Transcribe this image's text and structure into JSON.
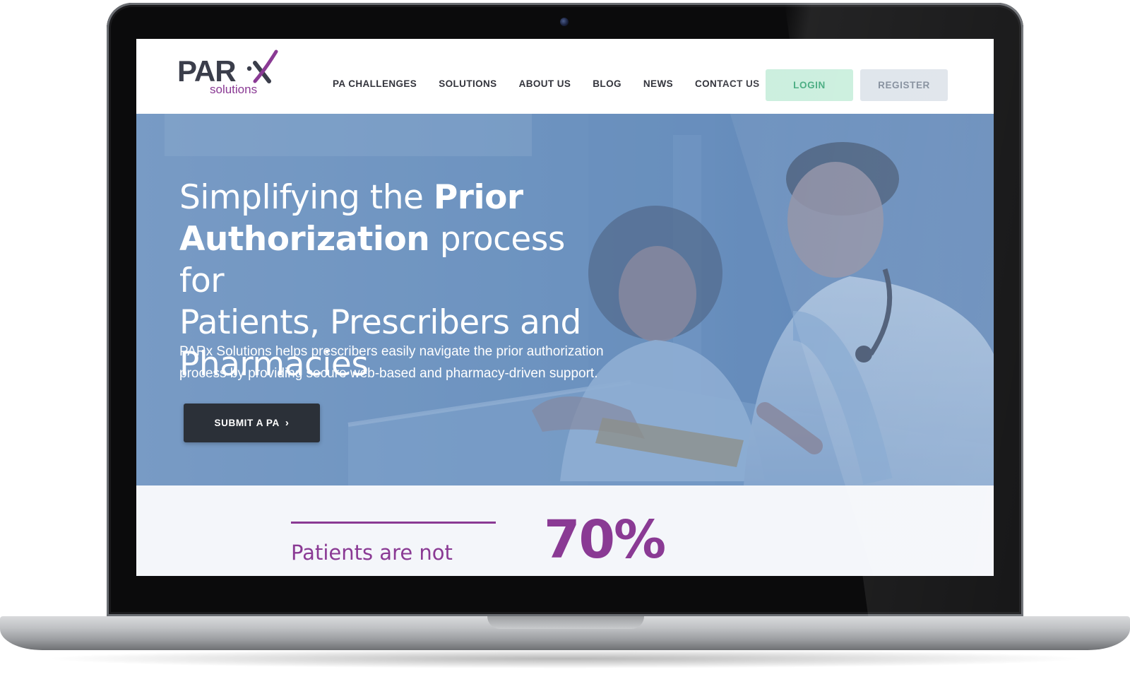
{
  "brand": {
    "logo_main": "PAR",
    "logo_sub": "solutions",
    "accent": "#8a3a94",
    "dark": "#3b3e4b"
  },
  "nav": {
    "items": [
      {
        "label": "PA CHALLENGES"
      },
      {
        "label": "SOLUTIONS"
      },
      {
        "label": "ABOUT US"
      },
      {
        "label": "BLOG"
      },
      {
        "label": "NEWS"
      },
      {
        "label": "CONTACT US"
      }
    ],
    "login_label": "LOGIN",
    "register_label": "REGISTER",
    "login_color": "#c8eedc",
    "register_color": "#dde3ea"
  },
  "hero": {
    "title_line1_plain": "Simplifying the ",
    "title_line1_bold": "Prior",
    "title_line2_bold": "Authorization",
    "title_line2_plain": " process for",
    "title_line3": "Patients, Prescribers and",
    "title_line4": "Pharmacies",
    "subtitle_line1": "PARx Solutions helps prescribers easily navigate the prior authorization",
    "subtitle_line2": "process by providing secure web-based and pharmacy-driven support.",
    "cta_label": "SUBMIT A PA",
    "cta_icon": "chevron-right-icon",
    "overlay_color": "#6b90bf"
  },
  "stats": {
    "caption": "Patients are not",
    "value": "70%"
  }
}
